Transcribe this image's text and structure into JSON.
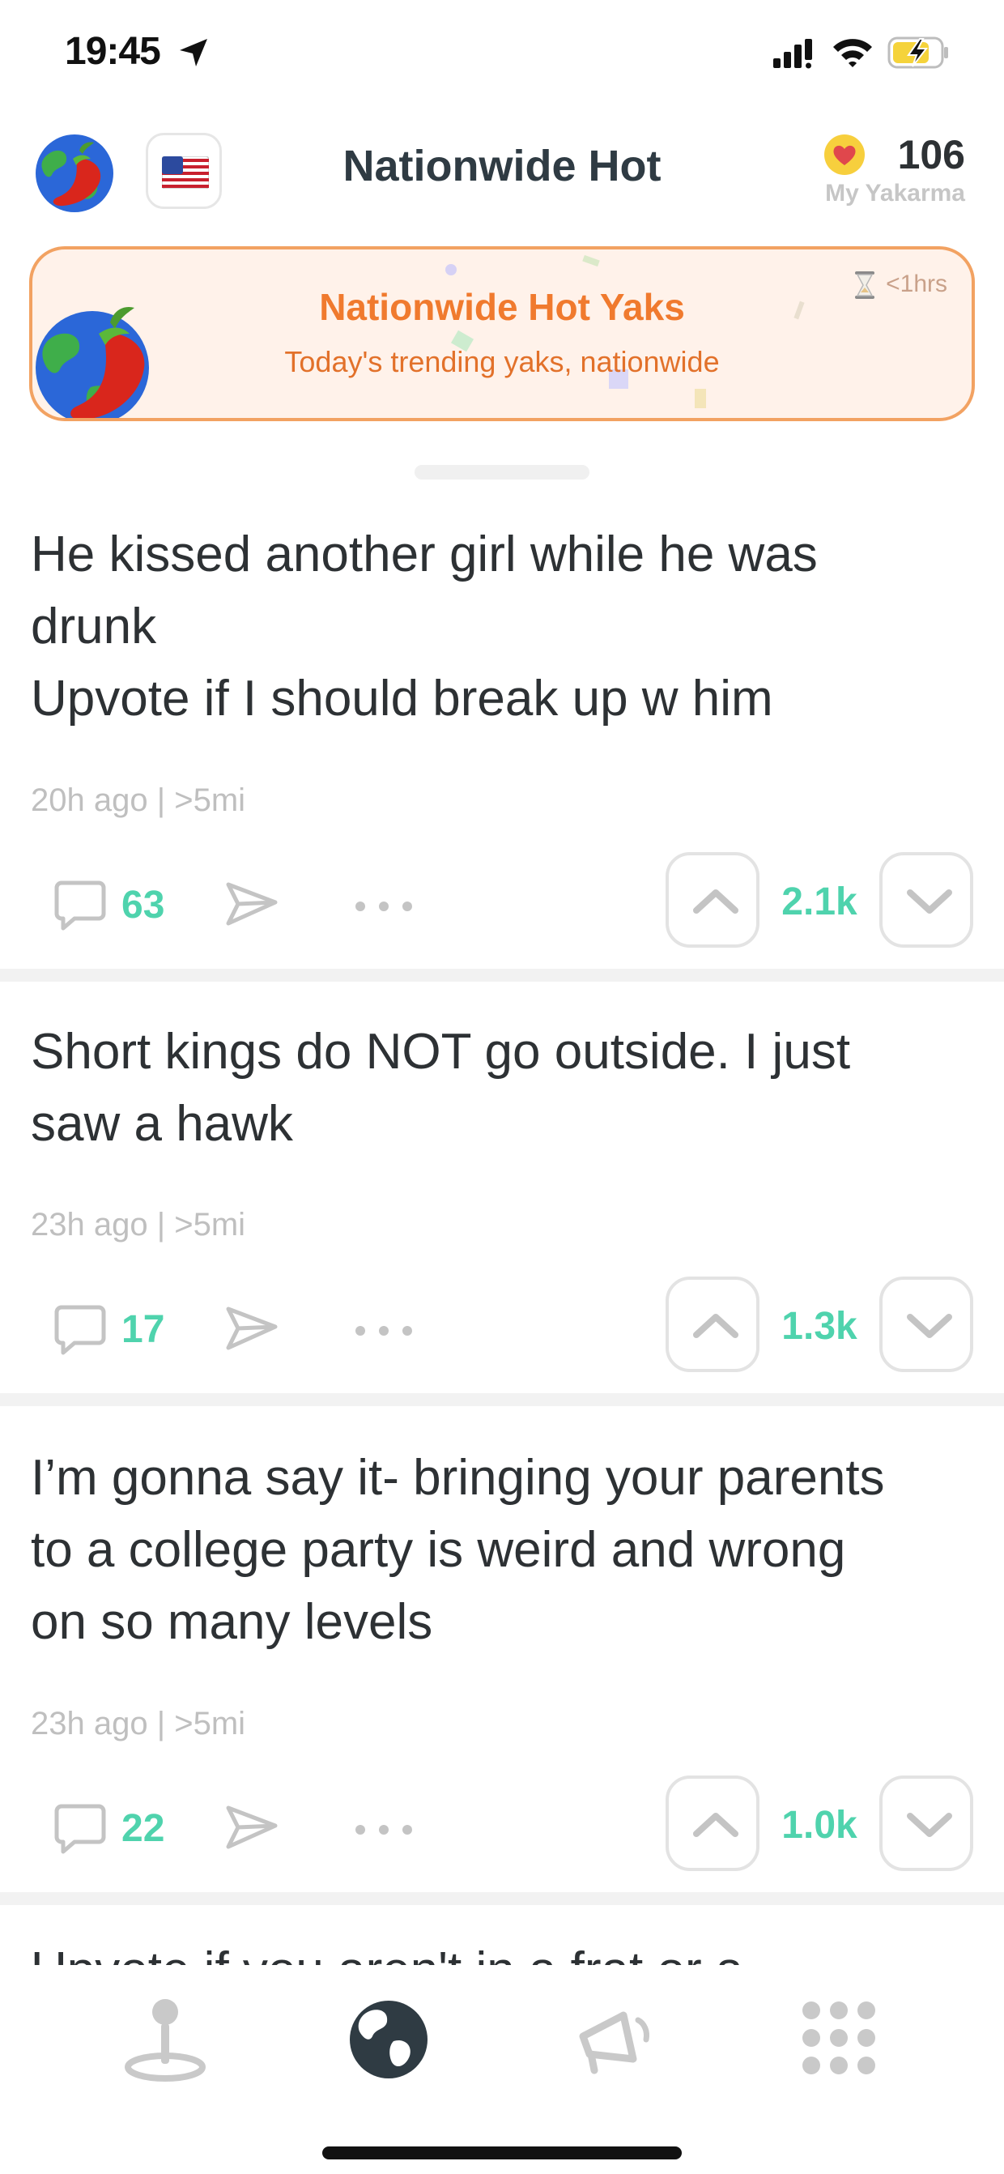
{
  "status_bar": {
    "time": "19:45",
    "icons": [
      "location-arrow-icon",
      "signal-icon",
      "wifi-icon",
      "battery-charging-icon"
    ]
  },
  "header": {
    "title": "Nationwide Hot",
    "left_icon": "hot-globe-icon",
    "flag_icon": "us-flag-icon",
    "yakarma_score": "106",
    "yakarma_label": "My Yakarma"
  },
  "banner": {
    "title": "Nationwide Hot Yaks",
    "subtitle": "Today's trending yaks, nationwide",
    "timer": "<1hrs",
    "colors": {
      "border": "#f2a262",
      "background": "#fff2ea",
      "title": "#f07a2e"
    }
  },
  "posts": [
    {
      "lines": [
        "He kissed another girl while he was",
        "drunk",
        "Upvote if I should break up w him"
      ],
      "meta": "20h ago | >5mi",
      "comments": "63",
      "votes": "2.1k"
    },
    {
      "lines": [
        "Short kings do NOT go outside. I just",
        "saw a hawk"
      ],
      "meta": "23h ago | >5mi",
      "comments": "17",
      "votes": "1.3k"
    },
    {
      "lines": [
        "I’m gonna say it- bringing your parents",
        "to a college party is weird and wrong",
        "on so many levels"
      ],
      "meta": "23h ago | >5mi",
      "comments": "22",
      "votes": "1.0k"
    }
  ],
  "peek_post": "Upvote if you aren't in a frat or a",
  "tab_bar": {
    "tabs": [
      "location-pin-icon",
      "globe-icon",
      "megaphone-icon",
      "grid-dots-icon"
    ],
    "active_tab": "globe-icon"
  },
  "colors": {
    "accent_green": "#4fd3ad",
    "meta_gray": "#bfbfbf",
    "text": "#2d3134"
  }
}
